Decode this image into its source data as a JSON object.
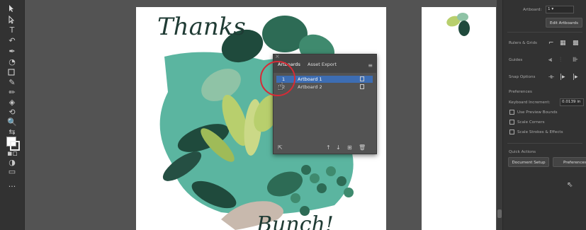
{
  "toolbar": {
    "tools": [
      "selection-tool",
      "direct-selection-tool",
      "type-tool",
      "lasso-tool",
      "pen-tool",
      "curvature-tool",
      "rectangle-tool",
      "shaper-tool",
      "pencil-tool",
      "eraser-tool",
      "rotate-tool",
      "scale-tool",
      "width-tool",
      "zoom-tool",
      "fill-stroke",
      "drawing-modes",
      "screen-mode",
      "more-tools"
    ]
  },
  "canvas": {
    "artboard1_text_top": "Thanks",
    "artboard1_text_bottom": "Bunch!"
  },
  "artboards_panel": {
    "tab_artboards": "Artboards",
    "tab_asset_export": "Asset Export",
    "rows": [
      {
        "num": "1",
        "name": "Artboard 1",
        "selected": true
      },
      {
        "num": "2",
        "name": "Artboard 2",
        "selected": false
      }
    ]
  },
  "properties": {
    "artboard_label": "Artboard:",
    "artboard_value": "1",
    "edit_artboards": "Edit Artboards",
    "rulers_grids": "Rulers & Grids",
    "guides": "Guides",
    "snap_options": "Snap Options",
    "preferences_heading": "Preferences",
    "keyboard_increment_label": "Keyboard Increment:",
    "keyboard_increment_value": "0.0139 in",
    "use_preview_bounds": "Use Preview Bounds",
    "scale_corners": "Scale Corners",
    "scale_strokes_effects": "Scale Strokes & Effects",
    "quick_actions": "Quick Actions",
    "document_setup": "Document Setup",
    "preferences_button": "Preferences"
  },
  "colors": {
    "canvas_bg": "#535353",
    "panel_bg": "#323232",
    "selection_blue": "#3d6db3",
    "highlight_red": "#d62b36",
    "leaf_dark": "#1f4a3c",
    "leaf_teal": "#5bb5a0",
    "leaf_lime": "#b8cf6d"
  }
}
